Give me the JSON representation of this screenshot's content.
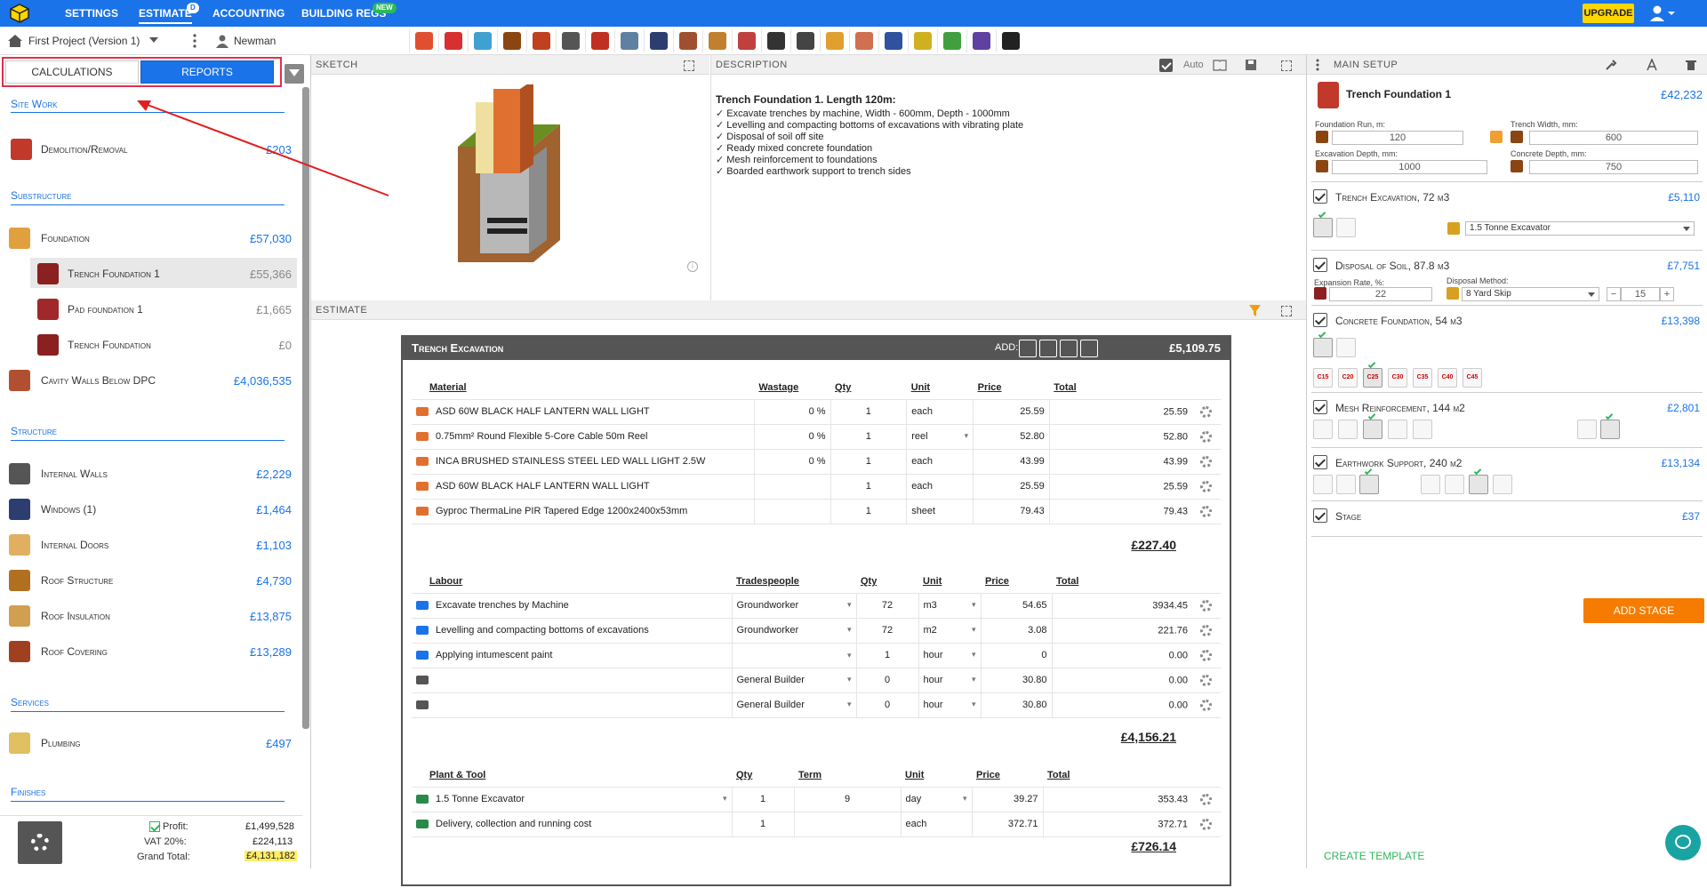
{
  "nav": {
    "items": [
      {
        "label": "SETTINGS"
      },
      {
        "label": "ESTIMATE",
        "badge": "D"
      },
      {
        "label": "ACCOUNTING"
      },
      {
        "label": "BUILDING REGS",
        "badge": "NEW"
      }
    ],
    "upgrade_label": "UPGRADE"
  },
  "project": {
    "name": "First Project (Version 1)",
    "client": "Newman",
    "tool_icons": [
      "foundation-icon",
      "triangle-warning-icon",
      "pipe-icon",
      "roof-shingle-icon",
      "brick-wall-icon",
      "roof-slab-icon",
      "brick-icon",
      "plaster-icon",
      "window-icon",
      "envelope-icon",
      "tools-icon",
      "roof-icon",
      "lightbulb-icon",
      "tap-icon",
      "heater-icon",
      "tile-icon",
      "paint-icon",
      "electric-icon",
      "tree-icon",
      "coins-icon",
      "person-icon"
    ]
  },
  "left": {
    "tab_calculations": "CALCULATIONS",
    "tab_reports": "REPORTS",
    "sections": [
      {
        "title": "Site Work",
        "items": [
          {
            "label": "Demolition/Removal",
            "value": "£203"
          }
        ]
      },
      {
        "title": "Substructure",
        "items": [
          {
            "label": "Foundation",
            "value": "£57,030"
          },
          {
            "label": "Trench Foundation 1",
            "value": "£55,366"
          },
          {
            "label": "Pad foundation 1",
            "value": "£1,665"
          },
          {
            "label": "Trench Foundation",
            "value": "£0"
          },
          {
            "label": "Cavity Walls Below DPC",
            "value": "£4,036,535"
          }
        ]
      },
      {
        "title": "Structure",
        "items": [
          {
            "label": "Internal Walls",
            "value": "£2,229"
          },
          {
            "label": "Windows (1)",
            "value": "£1,464"
          },
          {
            "label": "Internal Doors",
            "value": "£1,103"
          },
          {
            "label": "Roof Structure",
            "value": "£4,730"
          },
          {
            "label": "Roof Insulation",
            "value": "£13,875"
          },
          {
            "label": "Roof Covering",
            "value": "£13,289"
          }
        ]
      },
      {
        "title": "Services",
        "items": [
          {
            "label": "Plumbing",
            "value": "£497"
          }
        ]
      },
      {
        "title": "Finishes",
        "items": []
      }
    ],
    "footer": {
      "profit_label": "Profit:",
      "profit": "£1,499,528",
      "vat_label": "VAT 20%:",
      "vat": "£224,113",
      "total_label": "Grand Total:",
      "total": "£4,131,182"
    }
  },
  "sketch": {
    "title": "SKETCH"
  },
  "description": {
    "header": "DESCRIPTION",
    "auto_label": "Auto",
    "title": "Trench Foundation 1.    Length 120m:",
    "lines": [
      "Excavate trenches by machine, Width - 600mm, Depth - 1000mm",
      "Levelling and compacting bottoms of excavations with vibrating plate",
      "Disposal of soil off site",
      "Ready mixed concrete foundation",
      "Mesh reinforcement to foundations",
      "Boarded earthwork support to trench sides"
    ]
  },
  "estimate": {
    "header": "ESTIMATE",
    "title": "Trench Excavation",
    "add_label": "ADD:",
    "total": "£5,109.75",
    "materials": {
      "headers": [
        "Material",
        "Wastage",
        "Qty",
        "Unit",
        "Price",
        "Total"
      ],
      "rows": [
        [
          "ASD 60W BLACK HALF LANTERN WALL LIGHT",
          "0 %",
          "1",
          "each",
          "25.59",
          "25.59"
        ],
        [
          "0.75mm² Round Flexible 5-Core Cable 50m Reel",
          "0 %",
          "1",
          "reel",
          "52.80",
          "52.80"
        ],
        [
          "INCA BRUSHED STAINLESS STEEL LED WALL LIGHT 2.5W",
          "0 %",
          "1",
          "each",
          "43.99",
          "43.99"
        ],
        [
          "ASD 60W BLACK HALF LANTERN WALL LIGHT",
          "",
          "1",
          "each",
          "25.59",
          "25.59"
        ],
        [
          "Gyproc ThermaLine PIR Tapered Edge 1200x2400x53mm",
          "",
          "1",
          "sheet",
          "79.43",
          "79.43"
        ]
      ],
      "subtotal": "£227.40"
    },
    "labour": {
      "headers": [
        "Labour",
        "Tradespeople",
        "Qty",
        "Unit",
        "Price",
        "Total"
      ],
      "rows": [
        [
          "Excavate trenches by Machine",
          "Groundworker",
          "72",
          "m3",
          "54.65",
          "3934.45"
        ],
        [
          "Levelling and compacting bottoms of excavations",
          "Groundworker",
          "72",
          "m2",
          "3.08",
          "221.76"
        ],
        [
          "Applying intumescent paint",
          "",
          "1",
          "hour",
          "0",
          "0.00"
        ],
        [
          "",
          "General Builder",
          "0",
          "hour",
          "30.80",
          "0.00"
        ],
        [
          "",
          "General Builder",
          "0",
          "hour",
          "30.80",
          "0.00"
        ]
      ],
      "subtotal": "£4,156.21"
    },
    "plant": {
      "headers": [
        "Plant & Tool",
        "Qty",
        "Term",
        "Unit",
        "Price",
        "Total"
      ],
      "rows": [
        [
          "1.5 Tonne Excavator",
          "1",
          "9",
          "day",
          "39.27",
          "353.43"
        ],
        [
          "Delivery, collection and running cost",
          "1",
          "",
          "each",
          "372.71",
          "372.71"
        ]
      ],
      "subtotal": "£726.14"
    }
  },
  "right": {
    "header": "MAIN SETUP",
    "foundation_title": "Trench Foundation 1",
    "foundation_total": "£42,232",
    "inputs": {
      "run_label": "Foundation Run, m:",
      "run": "120",
      "width_label": "Trench Width, mm:",
      "width": "600",
      "exc_label": "Excavation Depth, mm:",
      "exc": "1000",
      "conc_label": "Concrete Depth, mm:",
      "conc": "750"
    },
    "stages": [
      {
        "title": "Trench Excavation, 72 м3",
        "value": "£5,110",
        "select": "1.5 Tonne Excavator"
      },
      {
        "title": "Disposal of Soil, 87.8 м3",
        "value": "£7,751",
        "exp_label": "Expansion Rate, %:",
        "exp": "22",
        "method_label": "Disposal Method:",
        "method": "8 Yard Skip",
        "qty": "15"
      },
      {
        "title": "Concrete Foundation, 54 м3",
        "value": "£13,398",
        "grades": [
          "C15",
          "C20",
          "C25",
          "C30",
          "C35",
          "C40",
          "C45"
        ]
      },
      {
        "title": "Mesh Reinforcement, 144 м2",
        "value": "£2,801"
      },
      {
        "title": "Earthwork Support, 240 м2",
        "value": "£13,134"
      },
      {
        "title": "Stage",
        "value": "£37"
      }
    ],
    "add_stage": "ADD STAGE",
    "create_template": "CREATE TEMPLATE"
  }
}
